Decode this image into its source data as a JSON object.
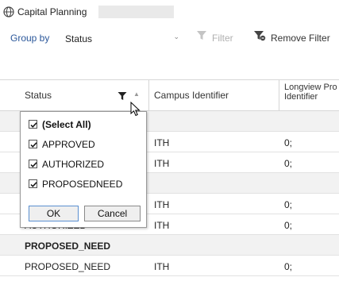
{
  "app": {
    "title": "Capital Planning",
    "icon": "globe-icon"
  },
  "toolbar": {
    "group_by_label": "Group by",
    "group_by_value": "Status",
    "filter_label": "Filter",
    "remove_filter_label": "Remove Filter"
  },
  "grid": {
    "headers": [
      "Status",
      "Campus Identifier",
      "Longview Pro Identifier"
    ],
    "header_long_line1": "Longview Pro",
    "header_long_line2": "Identifier",
    "rows": [
      {
        "type": "group",
        "c1": "",
        "c2": "",
        "c3": ""
      },
      {
        "type": "data",
        "c1": "",
        "c2": "ITH",
        "c3": "0;"
      },
      {
        "type": "data",
        "c1": "",
        "c2": "ITH",
        "c3": "0;"
      },
      {
        "type": "group",
        "c1": "",
        "c2": "",
        "c3": ""
      },
      {
        "type": "data",
        "c1": "",
        "c2": "ITH",
        "c3": "0;"
      },
      {
        "type": "data",
        "c1": "AUTHORIZED",
        "c2": "ITH",
        "c3": "0;"
      },
      {
        "type": "group",
        "c1": "PROPOSED_NEED",
        "c2": "",
        "c3": ""
      },
      {
        "type": "data",
        "c1": "PROPOSED_NEED",
        "c2": "ITH",
        "c3": "0;"
      }
    ]
  },
  "filter_popup": {
    "items": [
      {
        "label": "(Select All)",
        "checked": true
      },
      {
        "label": "APPROVED",
        "checked": true
      },
      {
        "label": "AUTHORIZED",
        "checked": true
      },
      {
        "label": "PROPOSEDNEED",
        "checked": true
      }
    ],
    "ok_label": "OK",
    "cancel_label": "Cancel"
  },
  "colors": {
    "accent": "#2b579a",
    "disabled": "#b0b0b0",
    "group_row": "#f2f2f2"
  }
}
